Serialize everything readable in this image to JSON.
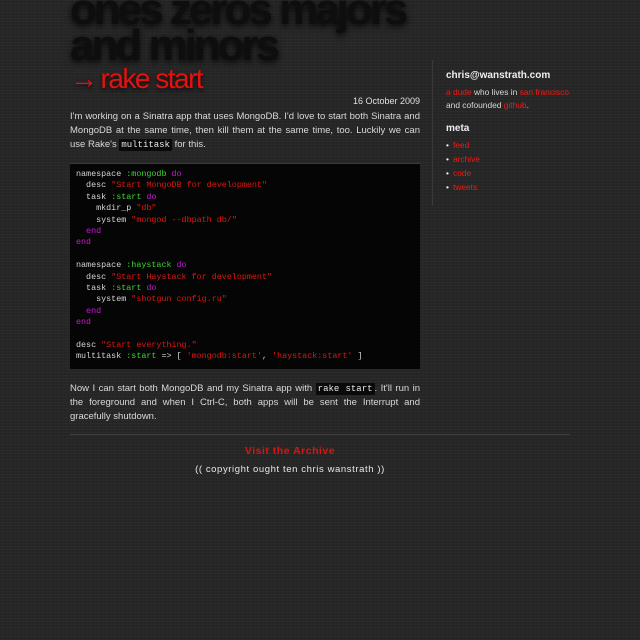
{
  "blog": {
    "title_line1": "ones zeros majors",
    "title_line2": "and minors"
  },
  "post": {
    "arrow": "→",
    "title": "rake start",
    "date": "16 October 2009",
    "intro_before_code": "I'm working on a Sinatra app that uses MongoDB. I'd love to start both Sinatra and MongoDB at the same time, then kill them at the same time, too. Luckily we can use Rake's ",
    "intro_code": "multitask",
    "intro_after_code": " for this.",
    "code_lines": [
      [
        {
          "t": "plain",
          "v": "namespace "
        },
        {
          "t": "sym",
          "v": ":mongodb"
        },
        {
          "t": "kw",
          "v": " do"
        }
      ],
      [
        {
          "t": "plain",
          "v": "  desc "
        },
        {
          "t": "str",
          "v": "\"Start MongoDB for development\""
        }
      ],
      [
        {
          "t": "plain",
          "v": "  task "
        },
        {
          "t": "sym",
          "v": ":start"
        },
        {
          "t": "kw",
          "v": " do"
        }
      ],
      [
        {
          "t": "plain",
          "v": "    mkdir_p "
        },
        {
          "t": "str",
          "v": "\"db\""
        }
      ],
      [
        {
          "t": "plain",
          "v": "    system "
        },
        {
          "t": "str",
          "v": "\"mongod --dbpath db/\""
        }
      ],
      [
        {
          "t": "kw",
          "v": "  end"
        }
      ],
      [
        {
          "t": "kw",
          "v": "end"
        }
      ],
      [],
      [
        {
          "t": "plain",
          "v": "namespace "
        },
        {
          "t": "sym",
          "v": ":haystack"
        },
        {
          "t": "kw",
          "v": " do"
        }
      ],
      [
        {
          "t": "plain",
          "v": "  desc "
        },
        {
          "t": "str",
          "v": "\"Start Haystack for development\""
        }
      ],
      [
        {
          "t": "plain",
          "v": "  task "
        },
        {
          "t": "sym",
          "v": ":start"
        },
        {
          "t": "kw",
          "v": " do"
        }
      ],
      [
        {
          "t": "plain",
          "v": "    system "
        },
        {
          "t": "str",
          "v": "\"shotgun config.ru\""
        }
      ],
      [
        {
          "t": "kw",
          "v": "  end"
        }
      ],
      [
        {
          "t": "kw",
          "v": "end"
        }
      ],
      [],
      [
        {
          "t": "plain",
          "v": "desc "
        },
        {
          "t": "str",
          "v": "\"Start everything.\""
        }
      ],
      [
        {
          "t": "plain",
          "v": "multitask "
        },
        {
          "t": "sym",
          "v": ":start"
        },
        {
          "t": "plain",
          "v": " => [ "
        },
        {
          "t": "str",
          "v": "'mongodb:start'"
        },
        {
          "t": "plain",
          "v": ", "
        },
        {
          "t": "str",
          "v": "'haystack:start'"
        },
        {
          "t": "plain",
          "v": " ]"
        }
      ]
    ],
    "outro_before_code": "Now I can start both MongoDB and my Sinatra app with ",
    "outro_code": "rake start",
    "outro_after_code": ". It'll run in the foreground and when I Ctrl-C, both apps will be sent the Interrupt and gracefully shutdown."
  },
  "sidebar": {
    "email": "chris@wanstrath.com",
    "bio_link_dude": "a dude",
    "bio_text_1": " who lives in ",
    "bio_link_sf": "san francisco",
    "bio_text_2": " and cofounded ",
    "bio_link_github": "github",
    "bio_text_3": ".",
    "meta_heading": "meta",
    "meta_links": [
      "feed",
      "archive",
      "code",
      "tweets"
    ]
  },
  "footer": {
    "archive_link": "Visit the Archive",
    "copyright": "(( copyright ought ten chris wanstrath ))"
  },
  "colors": {
    "background": "#262626",
    "accent_red": "#e4120e",
    "code_background": "#050505",
    "code_keyword": "#c41bd6",
    "code_symbol": "#3ed633",
    "code_string": "#e0160f"
  }
}
